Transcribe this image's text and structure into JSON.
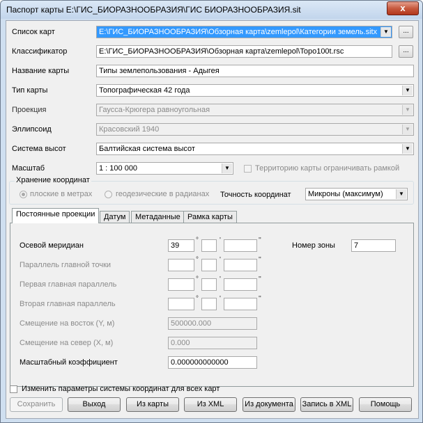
{
  "window": {
    "title": "Паспорт карты  E:\\ГИС_БИОРАЗНООБРАЗИЯ\\ГИС БИОРАЗНООБРАЗИЯ.sit",
    "close": "x"
  },
  "form": {
    "map_list": {
      "label": "Список карт",
      "value": "E:\\ГИС_БИОРАЗНООБРАЗИЯ\\Обзорная карта\\zemlepol\\Категории земель.sitx",
      "more": "..."
    },
    "classifier": {
      "label": "Классификатор",
      "value": "E:\\ГИС_БИОРАЗНООБРАЗИЯ\\Обзорная карта\\zemlepol\\Topo100t.rsc",
      "more": "..."
    },
    "map_name": {
      "label": "Название карты",
      "value": "Типы землепользования - Адыгея"
    },
    "map_type": {
      "label": "Тип карты",
      "value": "Топографическая 42 года"
    },
    "projection": {
      "label": "Проекция",
      "value": "Гаусса-Крюгера равноугольная"
    },
    "ellipsoid": {
      "label": "Эллипсоид",
      "value": "Красовский 1940"
    },
    "height_system": {
      "label": "Система высот",
      "value": "Балтийская система высот"
    },
    "scale": {
      "label": "Масштаб",
      "value": "1 : 100 000",
      "limit_label": "Территорию карты ограничивать рамкой"
    }
  },
  "coord_storage": {
    "legend": "Хранение координат",
    "radio_meters": "плоские в метрах",
    "radio_radians": "геодезические в радианах",
    "accuracy_label": "Точность координат",
    "accuracy_value": "Микроны (максимум)"
  },
  "tabs": [
    {
      "label": "Постоянные проекции"
    },
    {
      "label": "Датум"
    },
    {
      "label": "Метаданные"
    },
    {
      "label": "Рамка карты"
    }
  ],
  "projection_params": {
    "central_meridian": {
      "label": "Осевой меридиан",
      "deg": "39",
      "min": "",
      "sec": ""
    },
    "zone_number": {
      "label": "Номер зоны",
      "value": "7"
    },
    "main_point_parallel": {
      "label": "Параллель главной точки"
    },
    "first_parallel": {
      "label": "Первая главная параллель"
    },
    "second_parallel": {
      "label": "Вторая главная параллель"
    },
    "false_easting": {
      "label": "Смещение на восток (Y, м)",
      "value": "500000.000"
    },
    "false_northing": {
      "label": "Смещение на север (X, м)",
      "value": "0.000"
    },
    "scale_factor": {
      "label": "Масштабный коэффициент",
      "value": "0.000000000000"
    }
  },
  "symbols": {
    "deg": "°",
    "min": "'",
    "sec": "''"
  },
  "apply_all_label": "Изменить параметры системы координат для всех карт",
  "buttons": {
    "save": "Сохранить",
    "exit": "Выход",
    "from_map": "Из карты",
    "from_xml": "Из XML",
    "from_doc": "Из документа",
    "to_xml": "Запись в XML",
    "help": "Помощь"
  }
}
